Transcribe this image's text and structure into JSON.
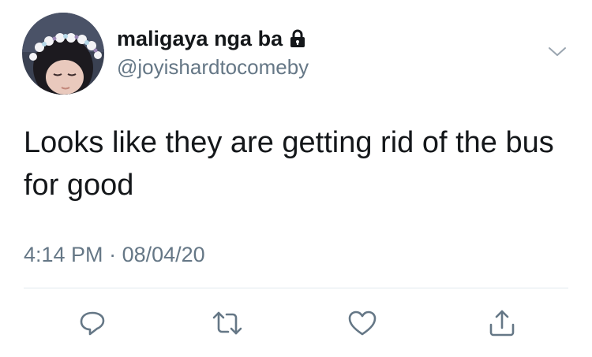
{
  "tweet": {
    "display_name": "maligaya nga ba",
    "handle": "@joyishardtocomeby",
    "text": "Looks like they are getting rid of the bus for good",
    "time": "4:14 PM",
    "separator": "·",
    "date": "08/04/20",
    "locked": true
  },
  "icons": {
    "lock": "lock-icon",
    "chevron": "chevron-down-icon",
    "reply": "reply-icon",
    "retweet": "retweet-icon",
    "like": "heart-icon",
    "share": "share-icon"
  },
  "colors": {
    "text_primary": "#14171a",
    "text_secondary": "#657786",
    "divider": "#e1e8ed"
  }
}
